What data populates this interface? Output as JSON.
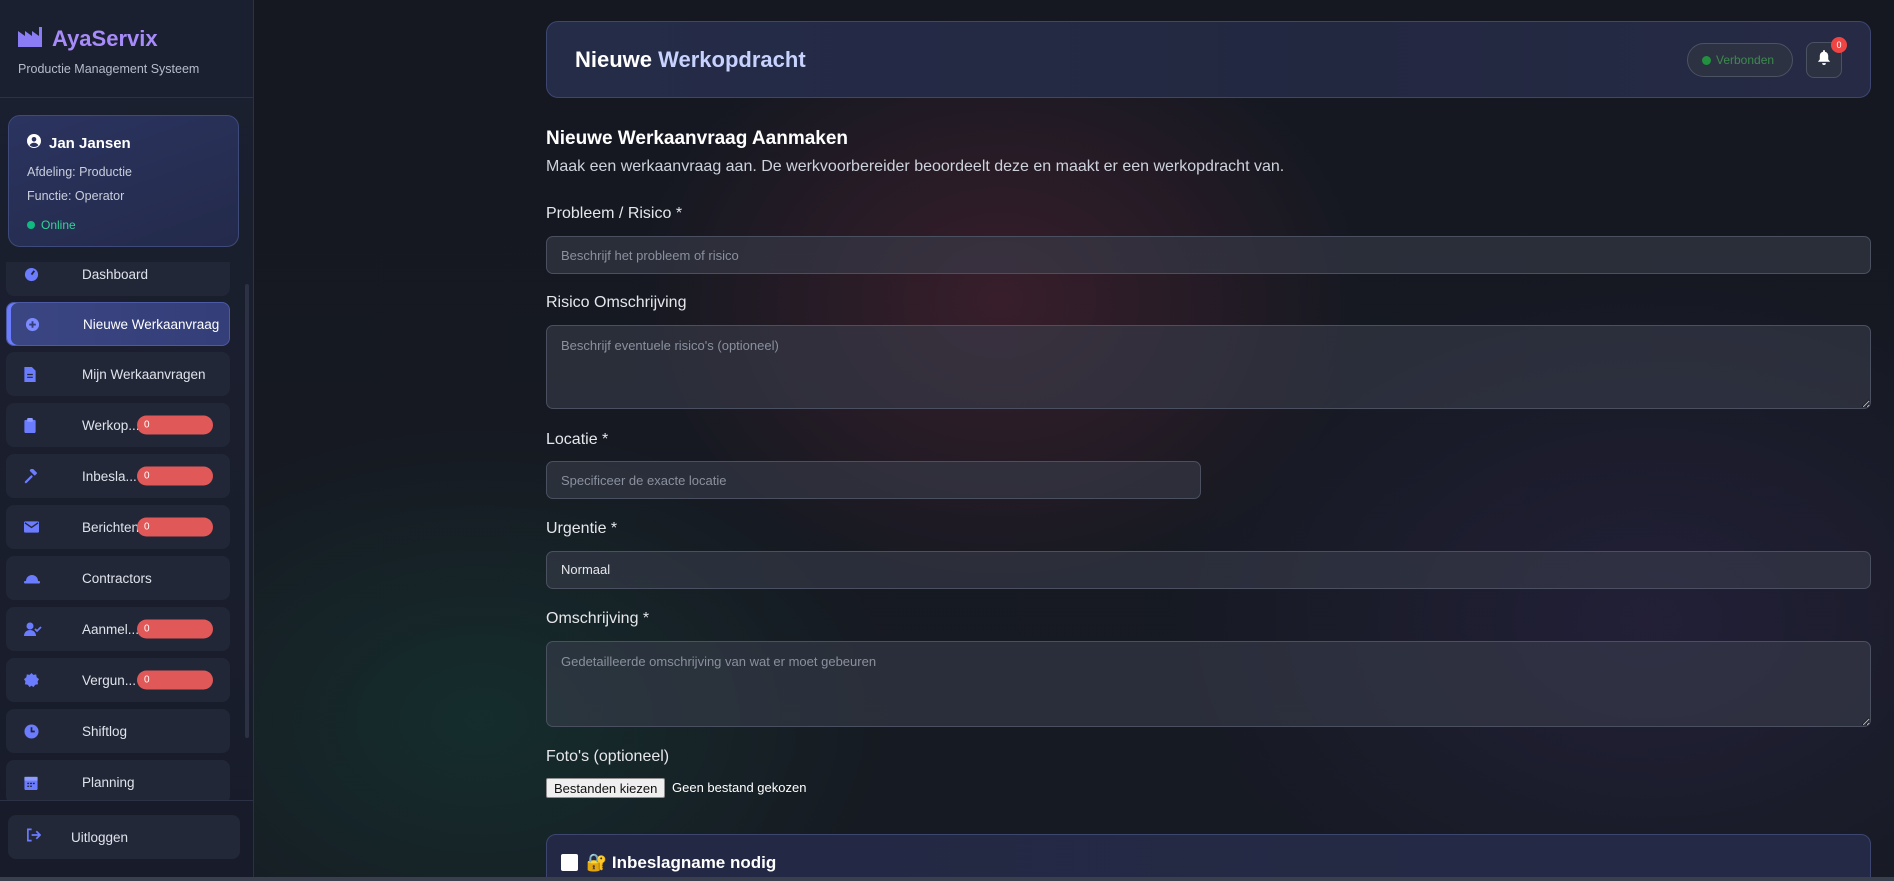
{
  "brand": {
    "title": "AyaServix",
    "subtitle": "Productie Management Systeem"
  },
  "user": {
    "name": "Jan Jansen",
    "department": "Afdeling: Productie",
    "role": "Functie: Operator",
    "status": "Online"
  },
  "nav": [
    {
      "label": "Dashboard",
      "icon": "dashboard-gauge-icon"
    },
    {
      "label": "Nieuwe Werkaanvraag",
      "icon": "plus-circle-icon",
      "active": true
    },
    {
      "label": "Mijn Werkaanvragen",
      "icon": "document-icon"
    },
    {
      "label": "Werkop...",
      "icon": "clipboard-icon",
      "badge": "0"
    },
    {
      "label": "Inbesla...",
      "icon": "gavel-icon",
      "badge": "0"
    },
    {
      "label": "Berichten",
      "icon": "envelope-icon",
      "badge": "0"
    },
    {
      "label": "Contractors",
      "icon": "hard-hat-icon"
    },
    {
      "label": "Aanmel...",
      "icon": "user-check-icon",
      "badge": "0"
    },
    {
      "label": "Vergun...",
      "icon": "certificate-icon",
      "badge": "0"
    },
    {
      "label": "Shiftlog",
      "icon": "clock-icon"
    },
    {
      "label": "Planning",
      "icon": "calendar-icon"
    }
  ],
  "logout": {
    "label": "Uitloggen"
  },
  "header": {
    "title_part1": "Nieuwe ",
    "title_part2": "Werkopdracht",
    "connection": "Verbonden",
    "notifications": "0"
  },
  "form": {
    "title": "Nieuwe Werkaanvraag Aanmaken",
    "subtitle": "Maak een werkaanvraag aan. De werkvoorbereider beoordeelt deze en maakt er een werkopdracht van.",
    "problem": {
      "label": "Probleem / Risico *",
      "placeholder": "Beschrijf het probleem of risico"
    },
    "risk": {
      "label": "Risico Omschrijving",
      "placeholder": "Beschrijf eventuele risico's (optioneel)"
    },
    "location": {
      "label": "Locatie *",
      "placeholder": "Specificeer de exacte locatie"
    },
    "urgency": {
      "label": "Urgentie *",
      "value": "Normaal"
    },
    "description": {
      "label": "Omschrijving *",
      "placeholder": "Gedetailleerde omschrijving van wat er moet gebeuren"
    },
    "photos": {
      "label": "Foto's (optioneel)",
      "button": "Bestanden kiezen",
      "none": "Geen bestand gekozen"
    },
    "seizure": {
      "label": "🔐 Inbeslagname nodig"
    }
  }
}
